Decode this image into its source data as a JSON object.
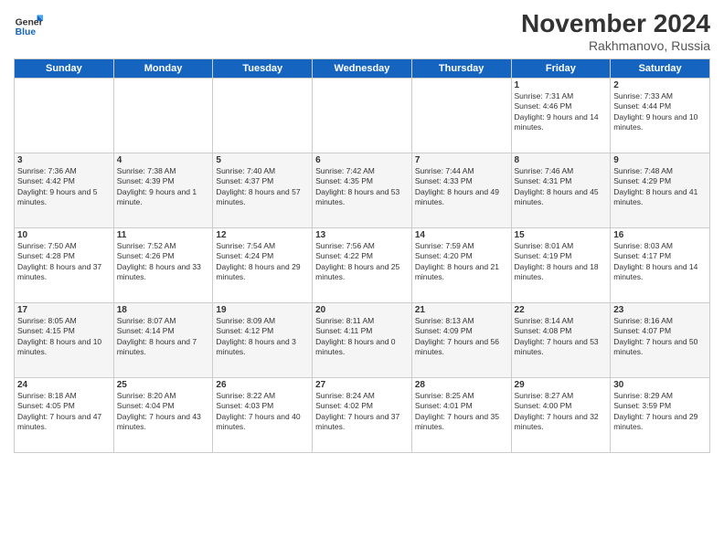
{
  "logo": {
    "general": "General",
    "blue": "Blue"
  },
  "title": "November 2024",
  "location": "Rakhmanovo, Russia",
  "days_header": [
    "Sunday",
    "Monday",
    "Tuesday",
    "Wednesday",
    "Thursday",
    "Friday",
    "Saturday"
  ],
  "weeks": [
    [
      {
        "day": "",
        "info": ""
      },
      {
        "day": "",
        "info": ""
      },
      {
        "day": "",
        "info": ""
      },
      {
        "day": "",
        "info": ""
      },
      {
        "day": "",
        "info": ""
      },
      {
        "day": "1",
        "info": "Sunrise: 7:31 AM\nSunset: 4:46 PM\nDaylight: 9 hours and 14 minutes."
      },
      {
        "day": "2",
        "info": "Sunrise: 7:33 AM\nSunset: 4:44 PM\nDaylight: 9 hours and 10 minutes."
      }
    ],
    [
      {
        "day": "3",
        "info": "Sunrise: 7:36 AM\nSunset: 4:42 PM\nDaylight: 9 hours and 5 minutes."
      },
      {
        "day": "4",
        "info": "Sunrise: 7:38 AM\nSunset: 4:39 PM\nDaylight: 9 hours and 1 minute."
      },
      {
        "day": "5",
        "info": "Sunrise: 7:40 AM\nSunset: 4:37 PM\nDaylight: 8 hours and 57 minutes."
      },
      {
        "day": "6",
        "info": "Sunrise: 7:42 AM\nSunset: 4:35 PM\nDaylight: 8 hours and 53 minutes."
      },
      {
        "day": "7",
        "info": "Sunrise: 7:44 AM\nSunset: 4:33 PM\nDaylight: 8 hours and 49 minutes."
      },
      {
        "day": "8",
        "info": "Sunrise: 7:46 AM\nSunset: 4:31 PM\nDaylight: 8 hours and 45 minutes."
      },
      {
        "day": "9",
        "info": "Sunrise: 7:48 AM\nSunset: 4:29 PM\nDaylight: 8 hours and 41 minutes."
      }
    ],
    [
      {
        "day": "10",
        "info": "Sunrise: 7:50 AM\nSunset: 4:28 PM\nDaylight: 8 hours and 37 minutes."
      },
      {
        "day": "11",
        "info": "Sunrise: 7:52 AM\nSunset: 4:26 PM\nDaylight: 8 hours and 33 minutes."
      },
      {
        "day": "12",
        "info": "Sunrise: 7:54 AM\nSunset: 4:24 PM\nDaylight: 8 hours and 29 minutes."
      },
      {
        "day": "13",
        "info": "Sunrise: 7:56 AM\nSunset: 4:22 PM\nDaylight: 8 hours and 25 minutes."
      },
      {
        "day": "14",
        "info": "Sunrise: 7:59 AM\nSunset: 4:20 PM\nDaylight: 8 hours and 21 minutes."
      },
      {
        "day": "15",
        "info": "Sunrise: 8:01 AM\nSunset: 4:19 PM\nDaylight: 8 hours and 18 minutes."
      },
      {
        "day": "16",
        "info": "Sunrise: 8:03 AM\nSunset: 4:17 PM\nDaylight: 8 hours and 14 minutes."
      }
    ],
    [
      {
        "day": "17",
        "info": "Sunrise: 8:05 AM\nSunset: 4:15 PM\nDaylight: 8 hours and 10 minutes."
      },
      {
        "day": "18",
        "info": "Sunrise: 8:07 AM\nSunset: 4:14 PM\nDaylight: 8 hours and 7 minutes."
      },
      {
        "day": "19",
        "info": "Sunrise: 8:09 AM\nSunset: 4:12 PM\nDaylight: 8 hours and 3 minutes."
      },
      {
        "day": "20",
        "info": "Sunrise: 8:11 AM\nSunset: 4:11 PM\nDaylight: 8 hours and 0 minutes."
      },
      {
        "day": "21",
        "info": "Sunrise: 8:13 AM\nSunset: 4:09 PM\nDaylight: 7 hours and 56 minutes."
      },
      {
        "day": "22",
        "info": "Sunrise: 8:14 AM\nSunset: 4:08 PM\nDaylight: 7 hours and 53 minutes."
      },
      {
        "day": "23",
        "info": "Sunrise: 8:16 AM\nSunset: 4:07 PM\nDaylight: 7 hours and 50 minutes."
      }
    ],
    [
      {
        "day": "24",
        "info": "Sunrise: 8:18 AM\nSunset: 4:05 PM\nDaylight: 7 hours and 47 minutes."
      },
      {
        "day": "25",
        "info": "Sunrise: 8:20 AM\nSunset: 4:04 PM\nDaylight: 7 hours and 43 minutes."
      },
      {
        "day": "26",
        "info": "Sunrise: 8:22 AM\nSunset: 4:03 PM\nDaylight: 7 hours and 40 minutes."
      },
      {
        "day": "27",
        "info": "Sunrise: 8:24 AM\nSunset: 4:02 PM\nDaylight: 7 hours and 37 minutes."
      },
      {
        "day": "28",
        "info": "Sunrise: 8:25 AM\nSunset: 4:01 PM\nDaylight: 7 hours and 35 minutes."
      },
      {
        "day": "29",
        "info": "Sunrise: 8:27 AM\nSunset: 4:00 PM\nDaylight: 7 hours and 32 minutes."
      },
      {
        "day": "30",
        "info": "Sunrise: 8:29 AM\nSunset: 3:59 PM\nDaylight: 7 hours and 29 minutes."
      }
    ]
  ]
}
